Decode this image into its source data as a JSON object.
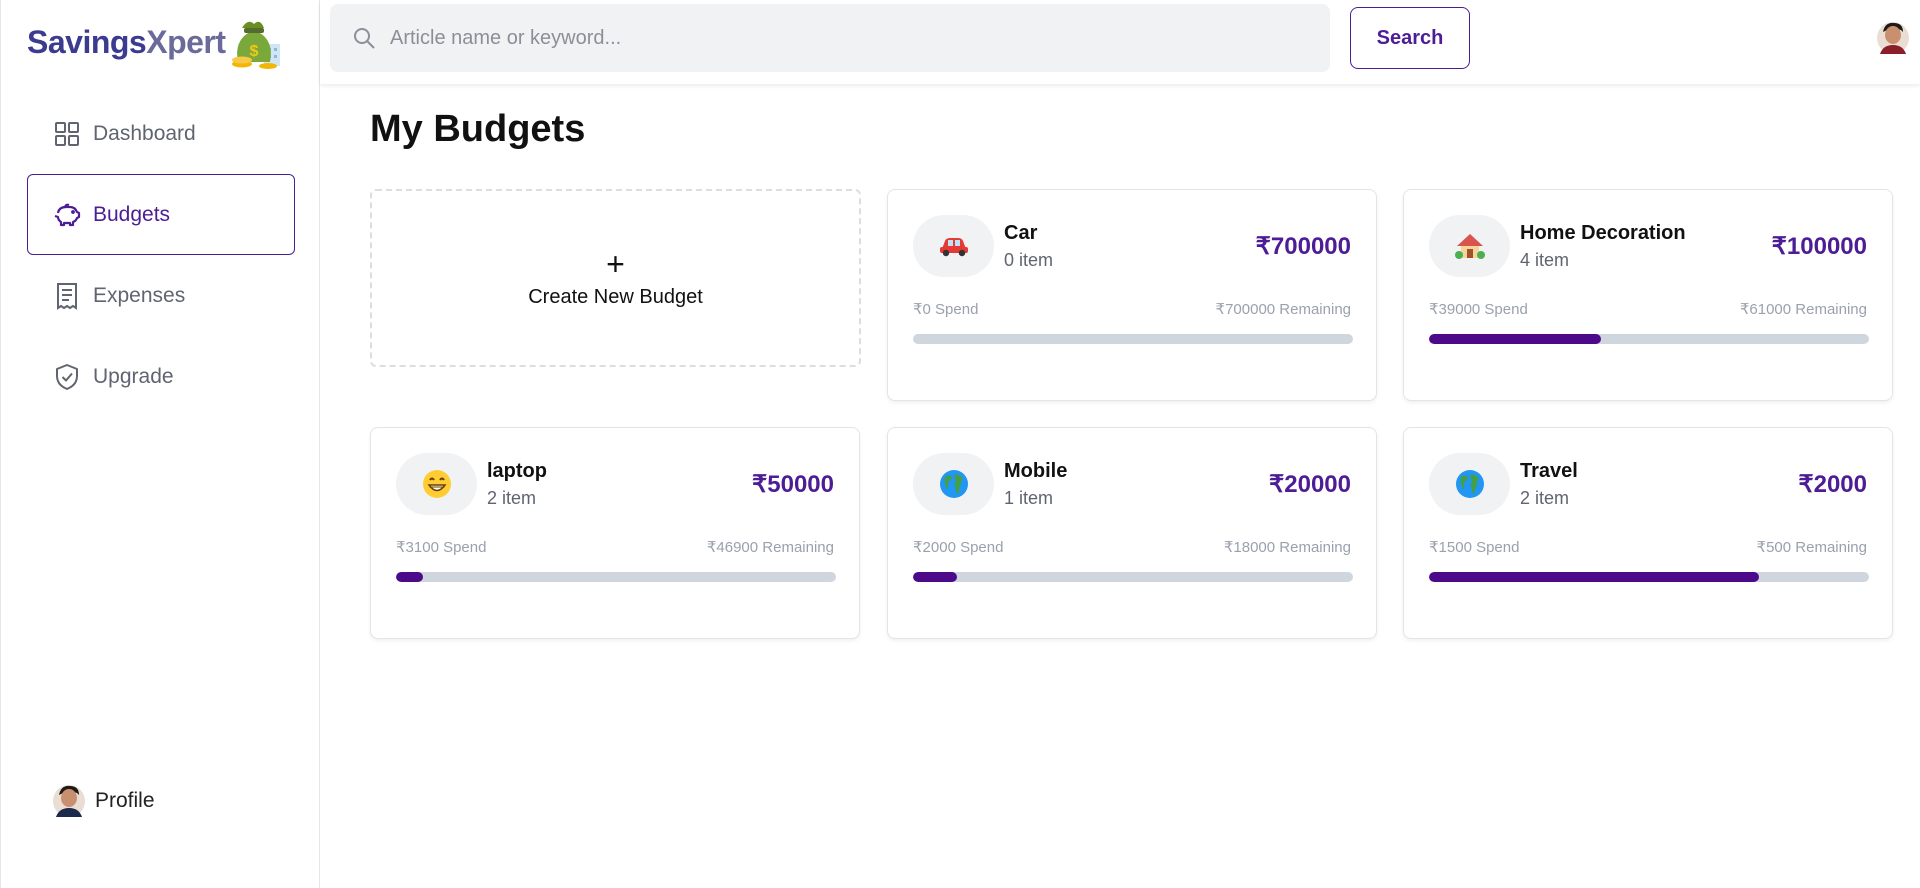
{
  "app": {
    "logo_part1": "Savings",
    "logo_part2": "Xpert"
  },
  "sidebar": {
    "items": [
      {
        "label": "Dashboard",
        "icon": "dashboard-grid-icon",
        "active": false
      },
      {
        "label": "Budgets",
        "icon": "piggy-bank-icon",
        "active": true
      },
      {
        "label": "Expenses",
        "icon": "receipt-icon",
        "active": false
      },
      {
        "label": "Upgrade",
        "icon": "shield-check-icon",
        "active": false
      }
    ],
    "profile_label": "Profile"
  },
  "header": {
    "search_placeholder": "Article name or keyword...",
    "search_button": "Search"
  },
  "main": {
    "title": "My Budgets",
    "create_plus": "+",
    "create_label": "Create New Budget",
    "budgets": [
      {
        "emoji": "🚗",
        "name": "Car",
        "items": "0 item",
        "amount": "₹700000",
        "spend": "₹0 Spend",
        "remaining": "₹700000 Remaining",
        "progress": 0
      },
      {
        "emoji": "🏠",
        "name": "Home Decoration",
        "items": "4 item",
        "amount": "₹100000",
        "spend": "₹39000 Spend",
        "remaining": "₹61000 Remaining",
        "progress": 0.39
      },
      {
        "emoji": "😁",
        "name": "laptop",
        "items": "2 item",
        "amount": "₹50000",
        "spend": "₹3100 Spend",
        "remaining": "₹46900 Remaining",
        "progress": 0.062
      },
      {
        "emoji": "🌍",
        "name": "Mobile",
        "items": "1 item",
        "amount": "₹20000",
        "spend": "₹2000 Spend",
        "remaining": "₹18000 Remaining",
        "progress": 0.1
      },
      {
        "emoji": "🌍",
        "name": "Travel",
        "items": "2 item",
        "amount": "₹2000",
        "spend": "₹1500 Spend",
        "remaining": "₹500 Remaining",
        "progress": 0.75
      }
    ]
  },
  "colors": {
    "accent": "#4c1d95",
    "progress_fill": "#4c0a8a",
    "progress_track": "#cfd6de"
  }
}
